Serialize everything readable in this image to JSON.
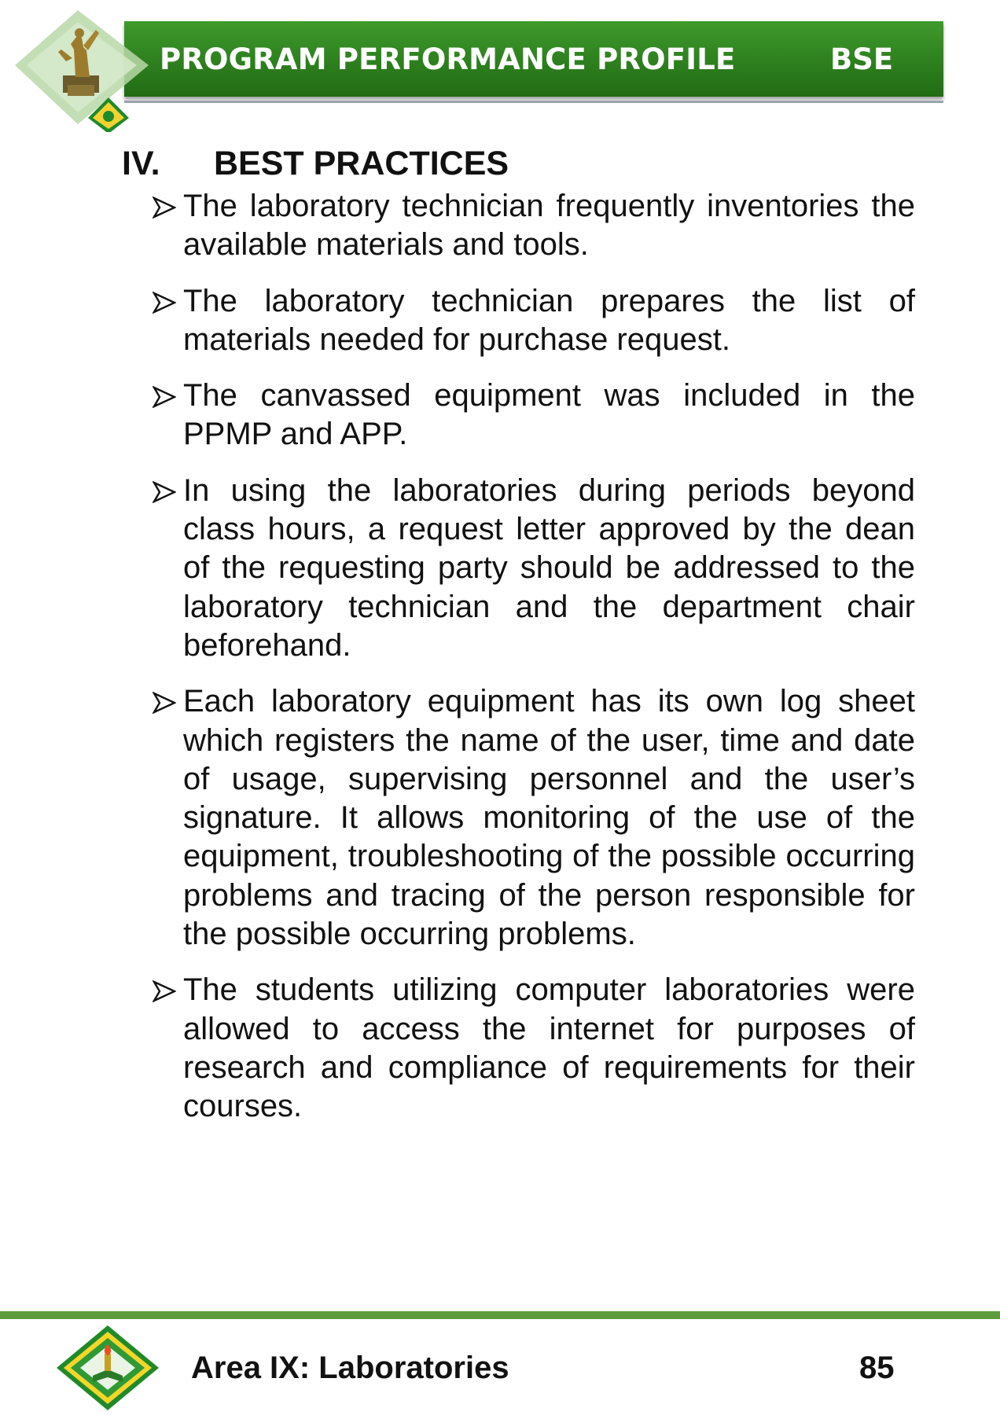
{
  "header": {
    "title": "PROGRAM PERFORMANCE PROFILE",
    "program_code": "BSE",
    "logo_icon": "university-seal-with-statue-icon",
    "bar_color": "#2c7d1d"
  },
  "section": {
    "number": "IV.",
    "title": "BEST PRACTICES",
    "bullet_icon": "arrowhead-bullet-icon"
  },
  "practices": [
    "The laboratory technician frequently inventories the available materials and tools.",
    "The laboratory technician prepares the list of materials needed for purchase request.",
    "The canvassed equipment was included in the PPMP and APP.",
    "In using the laboratories during periods beyond class hours, a request letter approved by the dean of the requesting party should be addressed to the laboratory technician and the department chair beforehand.",
    "Each laboratory equipment has its own log sheet which registers the name of the user, time and date of usage, supervising personnel and the user’s signature.  It allows monitoring of the use of the equipment, troubleshooting of the possible occurring problems and tracing of the person responsible for the possible occurring problems.",
    "The students utilizing computer laboratories were allowed to access the internet for purposes of research and compliance of requirements for their courses."
  ],
  "footer": {
    "area": "Area IX: Laboratories",
    "page_number": "85",
    "logo_icon": "university-seal-icon",
    "line_color": "#5e9a3e"
  }
}
